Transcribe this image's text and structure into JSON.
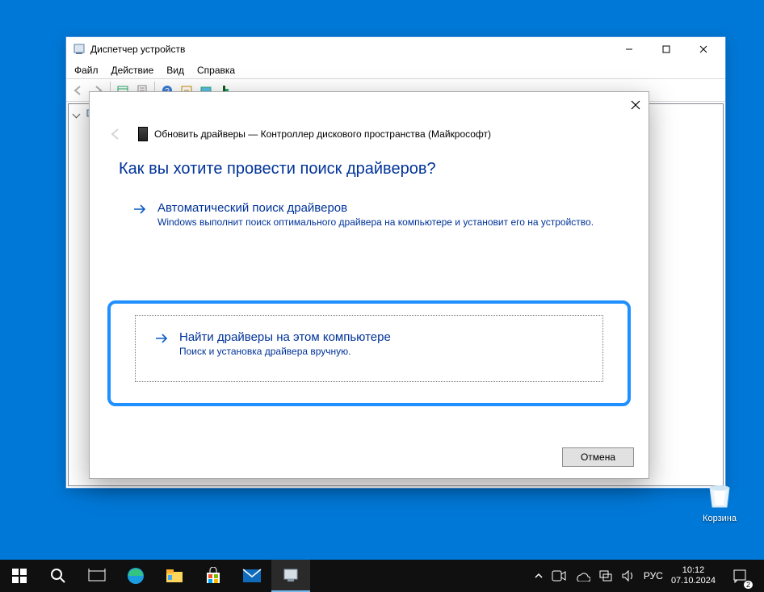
{
  "desktop": {
    "recycle_bin": "Корзина"
  },
  "devmgr": {
    "title": "Диспетчер устройств",
    "menus": {
      "file": "Файл",
      "action": "Действие",
      "view": "Вид",
      "help": "Справка"
    },
    "tree": {
      "root": "",
      "items": [
        "",
        "",
        "",
        "",
        "",
        "",
        "",
        "",
        "",
        "",
        "",
        "",
        "",
        "",
        "",
        "",
        ""
      ]
    }
  },
  "dialog": {
    "header": "Обновить драйверы — Контроллер дискового пространства (Майкрософт)",
    "question": "Как вы хотите провести поиск драйверов?",
    "option_auto": {
      "title": "Автоматический поиск драйверов",
      "sub": "Windows выполнит поиск оптимального драйвера на компьютере и установит его на устройство."
    },
    "option_manual": {
      "title": "Найти драйверы на этом компьютере",
      "sub": "Поиск и установка драйвера вручную."
    },
    "cancel": "Отмена"
  },
  "taskbar": {
    "lang": "РУС",
    "time": "10:12",
    "date": "07.10.2024",
    "notif_count": "2"
  }
}
